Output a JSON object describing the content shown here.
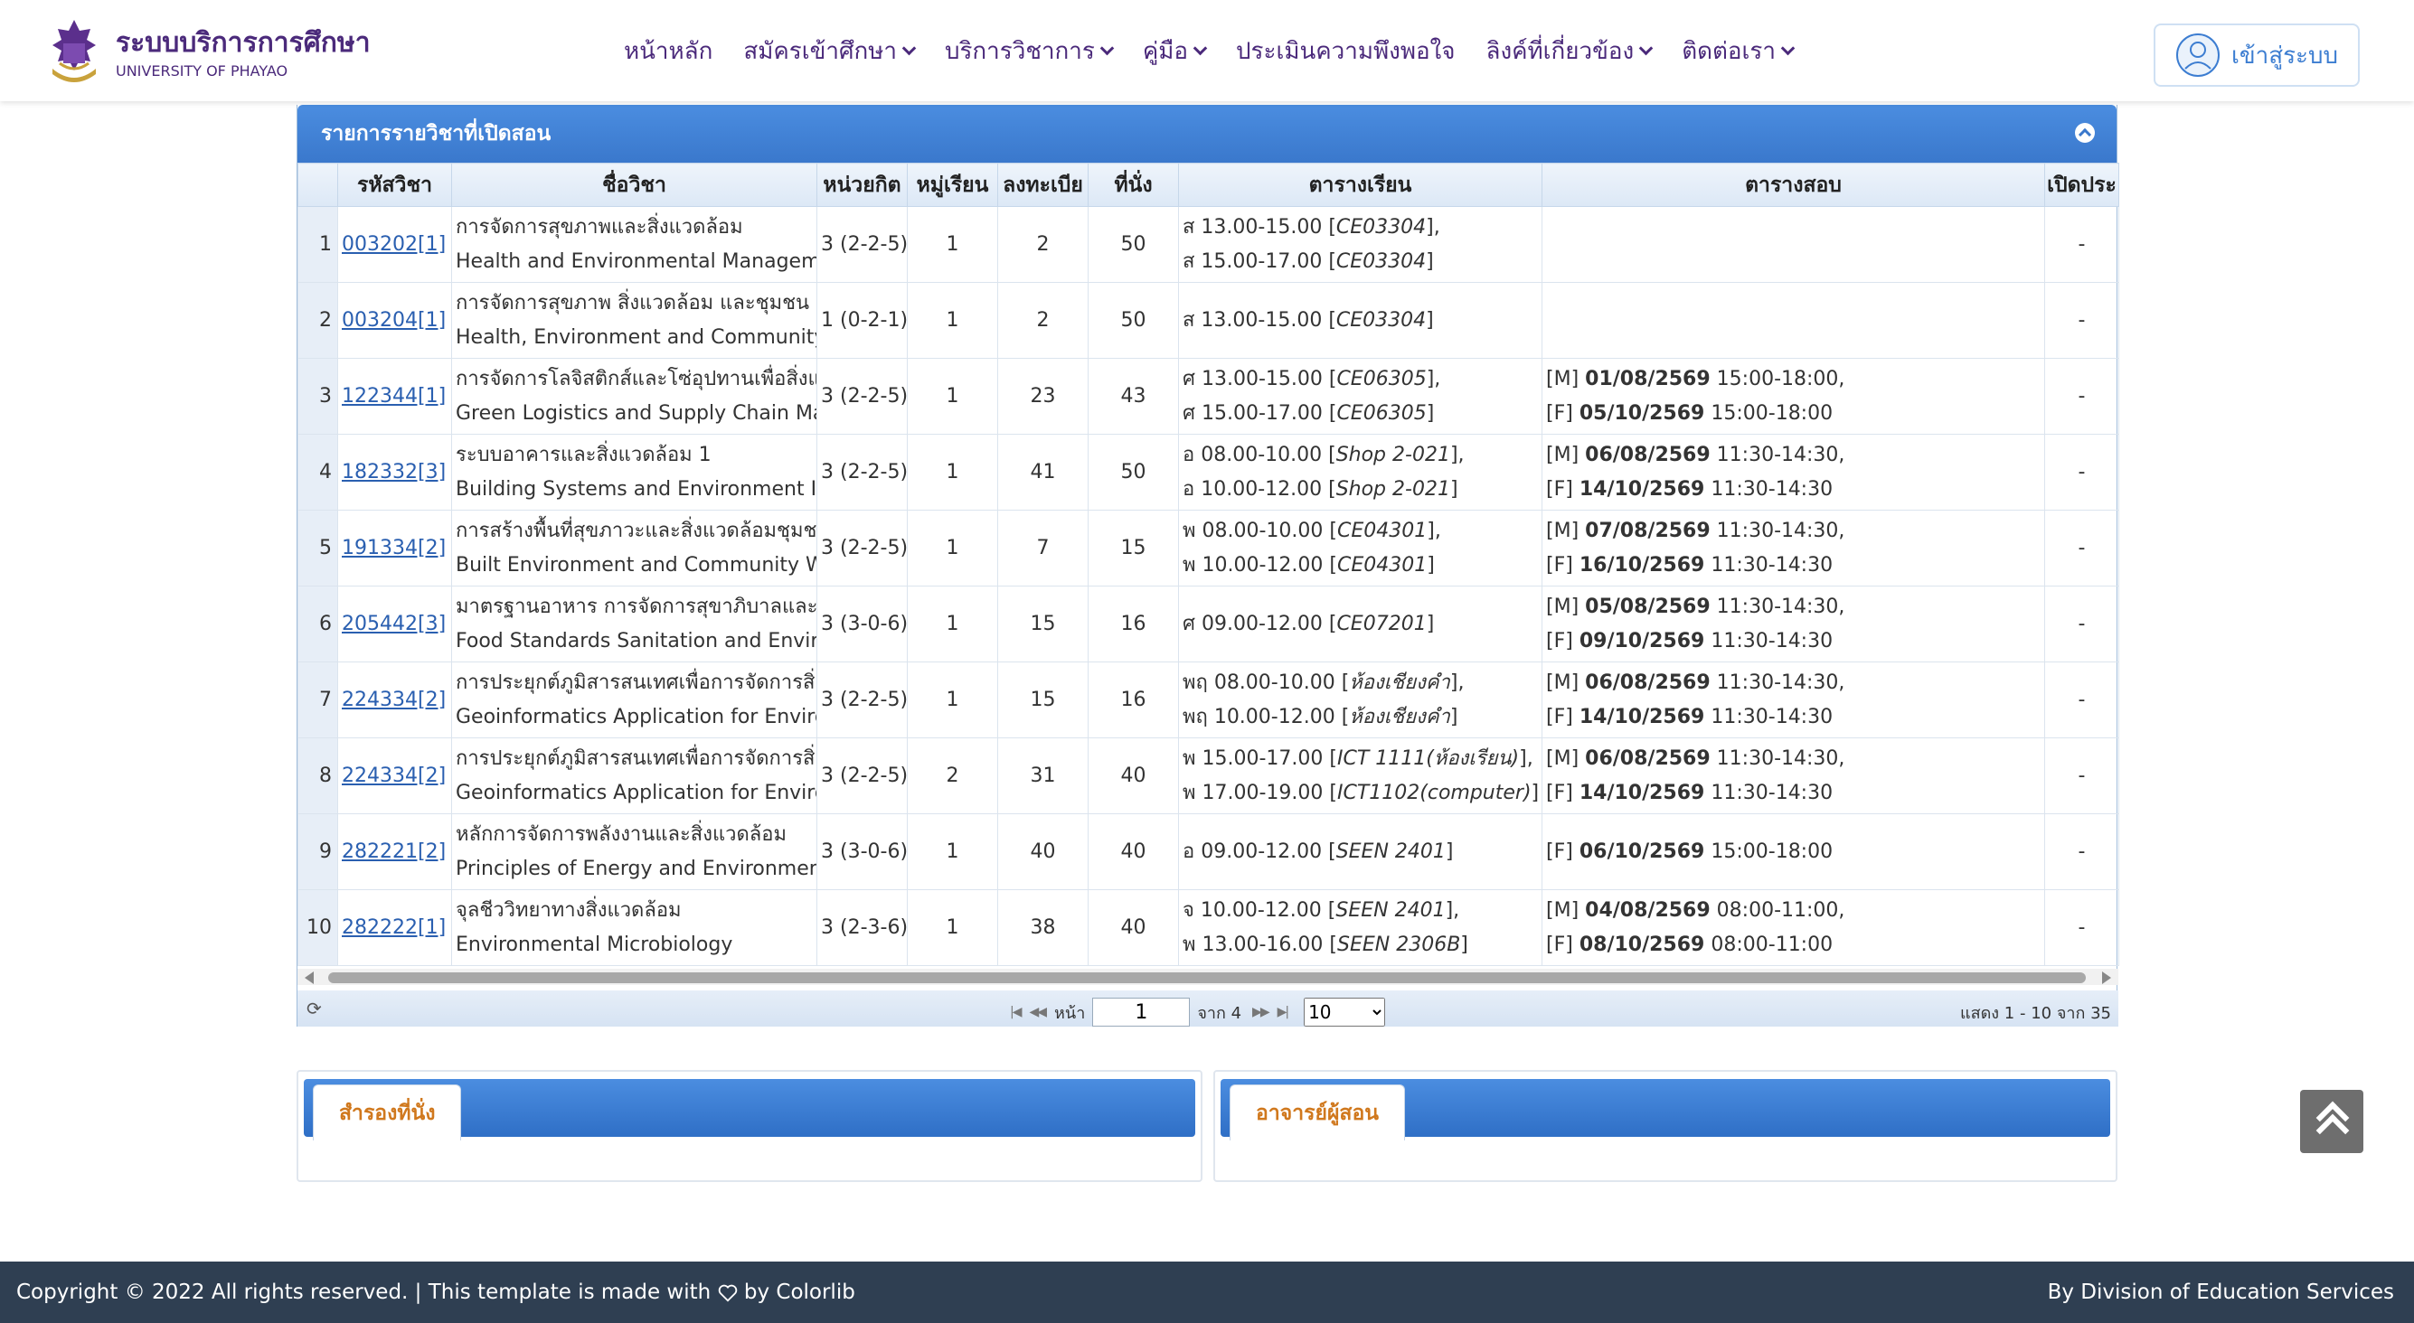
{
  "header": {
    "brand_title": "ระบบบริการการศึกษา",
    "brand_sub": "UNIVERSITY OF PHAYAO",
    "nav": [
      {
        "label": "หน้าหลัก",
        "dropdown": false
      },
      {
        "label": "สมัครเข้าศึกษา",
        "dropdown": true
      },
      {
        "label": "บริการวิชาการ",
        "dropdown": true
      },
      {
        "label": "คู่มือ",
        "dropdown": true
      },
      {
        "label": "ประเมินความพึงพอใจ",
        "dropdown": false
      },
      {
        "label": "ลิงค์ที่เกี่ยวข้อง",
        "dropdown": true
      },
      {
        "label": "ติดต่อเรา",
        "dropdown": true
      }
    ],
    "login_label": "เข้าสู่ระบบ"
  },
  "panel": {
    "title": "รายการรายวิชาที่เปิดสอน",
    "columns": [
      "",
      "รหัสวิชา",
      "ชื่อวิชา",
      "หน่วยกิต",
      "หมู่เรียน",
      "ลงทะเบีย",
      "ที่นั่ง",
      "ตารางเรียน",
      "ตารางสอบ",
      "เปิดประ"
    ],
    "rows": [
      {
        "no": "1",
        "code": "003202[1]",
        "name_th": "การจัดการสุขภาพและสิ่งแวดล้อม",
        "name_en": "Health and Environmental Management",
        "credit": "3 (2-2-5)",
        "section": "1",
        "enrolled": "2",
        "seats": "50",
        "schedule": [
          {
            "t": "ส 13.00-15.00 [",
            "r": "CE03304",
            "e": "],"
          },
          {
            "t": "ส 15.00-17.00 [",
            "r": "CE03304",
            "e": "]"
          }
        ],
        "exam": [],
        "open": "-"
      },
      {
        "no": "2",
        "code": "003204[1]",
        "name_th": "การจัดการสุขภาพ สิ่งแวดล้อม และชุมชน",
        "name_en": "Health, Environment and Community Ma",
        "credit": "1 (0-2-1)",
        "section": "1",
        "enrolled": "2",
        "seats": "50",
        "schedule": [
          {
            "t": "ส 13.00-15.00 [",
            "r": "CE03304",
            "e": "]"
          }
        ],
        "exam": [],
        "open": "-"
      },
      {
        "no": "3",
        "code": "122344[1]",
        "name_th": "การจัดการโลจิสติกส์และโซ่อุปทานเพื่อสิ่งแวดล้",
        "name_en": "Green Logistics and Supply Chain Manag",
        "credit": "3 (2-2-5)",
        "section": "1",
        "enrolled": "23",
        "seats": "43",
        "schedule": [
          {
            "t": "ศ 13.00-15.00 [",
            "r": "CE06305",
            "e": "],"
          },
          {
            "t": "ศ 15.00-17.00 [",
            "r": "CE06305",
            "e": "]"
          }
        ],
        "exam": [
          {
            "k": "[M] ",
            "d": "01/08/2569",
            "tm": " 15:00-18:00,"
          },
          {
            "k": "[F] ",
            "d": "05/10/2569",
            "tm": " 15:00-18:00"
          }
        ],
        "open": "-"
      },
      {
        "no": "4",
        "code": "182332[3]",
        "name_th": "ระบบอาคารและสิ่งแวดล้อม 1",
        "name_en": "Building Systems and Environment I",
        "credit": "3 (2-2-5)",
        "section": "1",
        "enrolled": "41",
        "seats": "50",
        "schedule": [
          {
            "t": "อ 08.00-10.00 [",
            "r": "Shop 2-021",
            "e": "],"
          },
          {
            "t": "อ 10.00-12.00 [",
            "r": "Shop 2-021",
            "e": "]"
          }
        ],
        "exam": [
          {
            "k": "[M] ",
            "d": "06/08/2569",
            "tm": " 11:30-14:30,"
          },
          {
            "k": "[F] ",
            "d": "14/10/2569",
            "tm": " 11:30-14:30"
          }
        ],
        "open": "-"
      },
      {
        "no": "5",
        "code": "191334[2]",
        "name_th": "การสร้างพื้นที่สุขภาวะและสิ่งแวดล้อมชุมชน",
        "name_en": "Built Environment and Community Wellb",
        "credit": "3 (2-2-5)",
        "section": "1",
        "enrolled": "7",
        "seats": "15",
        "schedule": [
          {
            "t": "พ 08.00-10.00 [",
            "r": "CE04301",
            "e": "],"
          },
          {
            "t": "พ 10.00-12.00 [",
            "r": "CE04301",
            "e": "]"
          }
        ],
        "exam": [
          {
            "k": "[M] ",
            "d": "07/08/2569",
            "tm": " 11:30-14:30,"
          },
          {
            "k": "[F] ",
            "d": "16/10/2569",
            "tm": " 11:30-14:30"
          }
        ],
        "open": "-"
      },
      {
        "no": "6",
        "code": "205442[3]",
        "name_th": "มาตรฐานอาหาร การจัดการสุขาภิบาลและสิ่งแวด",
        "name_en": "Food Standards Sanitation and Environm",
        "credit": "3 (3-0-6)",
        "section": "1",
        "enrolled": "15",
        "seats": "16",
        "schedule": [
          {
            "t": "ศ 09.00-12.00 [",
            "r": "CE07201",
            "e": "]"
          }
        ],
        "exam": [
          {
            "k": "[M] ",
            "d": "05/08/2569",
            "tm": " 11:30-14:30,"
          },
          {
            "k": "[F] ",
            "d": "09/10/2569",
            "tm": " 11:30-14:30"
          }
        ],
        "open": "-"
      },
      {
        "no": "7",
        "code": "224334[2]",
        "name_th": "การประยุกต์ภูมิสารสนเทศเพื่อการจัดการสิ่งแวด",
        "name_en": "Geoinformatics Application for Environm",
        "credit": "3 (2-2-5)",
        "section": "1",
        "enrolled": "15",
        "seats": "16",
        "schedule": [
          {
            "t": "พฤ 08.00-10.00 [",
            "r": "ห้องเชียงคำ",
            "e": "],"
          },
          {
            "t": "พฤ 10.00-12.00 [",
            "r": "ห้องเชียงคำ",
            "e": "]"
          }
        ],
        "exam": [
          {
            "k": "[M] ",
            "d": "06/08/2569",
            "tm": " 11:30-14:30,"
          },
          {
            "k": "[F] ",
            "d": "14/10/2569",
            "tm": " 11:30-14:30"
          }
        ],
        "open": "-"
      },
      {
        "no": "8",
        "code": "224334[2]",
        "name_th": "การประยุกต์ภูมิสารสนเทศเพื่อการจัดการสิ่งแวด",
        "name_en": "Geoinformatics Application for Environm",
        "credit": "3 (2-2-5)",
        "section": "2",
        "enrolled": "31",
        "seats": "40",
        "schedule": [
          {
            "t": "พ 15.00-17.00 [",
            "r": "ICT 1111(ห้องเรียน)",
            "e": "],"
          },
          {
            "t": "พ 17.00-19.00 [",
            "r": "ICT1102(computer)",
            "e": "]"
          }
        ],
        "exam": [
          {
            "k": "[M] ",
            "d": "06/08/2569",
            "tm": " 11:30-14:30,"
          },
          {
            "k": "[F] ",
            "d": "14/10/2569",
            "tm": " 11:30-14:30"
          }
        ],
        "open": "-"
      },
      {
        "no": "9",
        "code": "282221[2]",
        "name_th": "หลักการจัดการพลังงานและสิ่งแวดล้อม",
        "name_en": "Principles of Energy and Environment Ma",
        "credit": "3 (3-0-6)",
        "section": "1",
        "enrolled": "40",
        "seats": "40",
        "schedule": [
          {
            "t": "อ 09.00-12.00 [",
            "r": "SEEN 2401",
            "e": "]"
          }
        ],
        "exam": [
          {
            "k": "[F] ",
            "d": "06/10/2569",
            "tm": " 15:00-18:00"
          }
        ],
        "open": "-"
      },
      {
        "no": "10",
        "code": "282222[1]",
        "name_th": "จุลชีววิทยาทางสิ่งแวดล้อม",
        "name_en": "Environmental Microbiology",
        "credit": "3 (2-3-6)",
        "section": "1",
        "enrolled": "38",
        "seats": "40",
        "schedule": [
          {
            "t": "จ 10.00-12.00 [",
            "r": "SEEN 2401",
            "e": "],"
          },
          {
            "t": "พ 13.00-16.00 [",
            "r": "SEEN 2306B",
            "e": "]"
          }
        ],
        "exam": [
          {
            "k": "[M] ",
            "d": "04/08/2569",
            "tm": " 08:00-11:00,"
          },
          {
            "k": "[F] ",
            "d": "08/10/2569",
            "tm": " 08:00-11:00"
          }
        ],
        "open": "-"
      }
    ]
  },
  "pager": {
    "page_label": "หน้า",
    "page_value": "1",
    "of_label": "จาก 4",
    "page_size": "10",
    "page_size_options": [
      "10"
    ],
    "summary": "แสดง 1 - 10 จาก 35"
  },
  "seat_panel": {
    "tab_label": "สำรองที่นั่ง"
  },
  "instructor_panel": {
    "tab_label": "อาจารย์ผู้สอน"
  },
  "footer": {
    "left_a": "Copyright © 2022 All rights reserved. | This template is made with",
    "left_b": "by Colorlib",
    "right": "By Division of Education Services"
  },
  "colors": {
    "brand_purple": "#4b2a7b",
    "header_blue": "#3a78cc",
    "link_blue": "#2a5fb0",
    "tab_orange": "#d0781d",
    "footer_bg": "#2f3f52"
  }
}
